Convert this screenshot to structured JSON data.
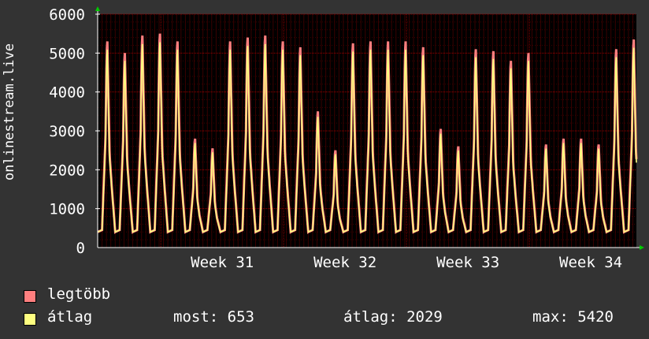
{
  "chart_data": {
    "type": "line",
    "ylabel": "onlinestream.live",
    "x_ticks": [
      "Week 31",
      "Week 32",
      "Week 33",
      "Week 34"
    ],
    "ylim": [
      0,
      6000
    ],
    "yticks": [
      0,
      1000,
      2000,
      3000,
      4000,
      5000,
      6000
    ],
    "grid": true,
    "daily_peaks": [
      5300,
      5000,
      5450,
      5500,
      5300,
      2800,
      2550,
      5300,
      5400,
      5450,
      5300,
      5150,
      3500,
      2500,
      5250,
      5300,
      5300,
      5300,
      5150,
      3050,
      2600,
      5100,
      5050,
      4800,
      5000,
      2650,
      2800,
      2800,
      2650,
      5100,
      5350
    ],
    "series": [
      {
        "name": "legtöbb",
        "color": "#ff7f7f"
      },
      {
        "name": "átlag",
        "color": "#ffff80"
      }
    ],
    "colors": {
      "background": "#333333",
      "plot": "#000000",
      "grid": "#9a0000",
      "axis": "#ffffff",
      "arrow": "#00cc00"
    }
  },
  "legend": {
    "max_label": "legtöbb",
    "avg_label": "átlag",
    "stats": {
      "now": "most: 653",
      "avg": "átlag: 2029",
      "max": "max: 5420"
    }
  }
}
